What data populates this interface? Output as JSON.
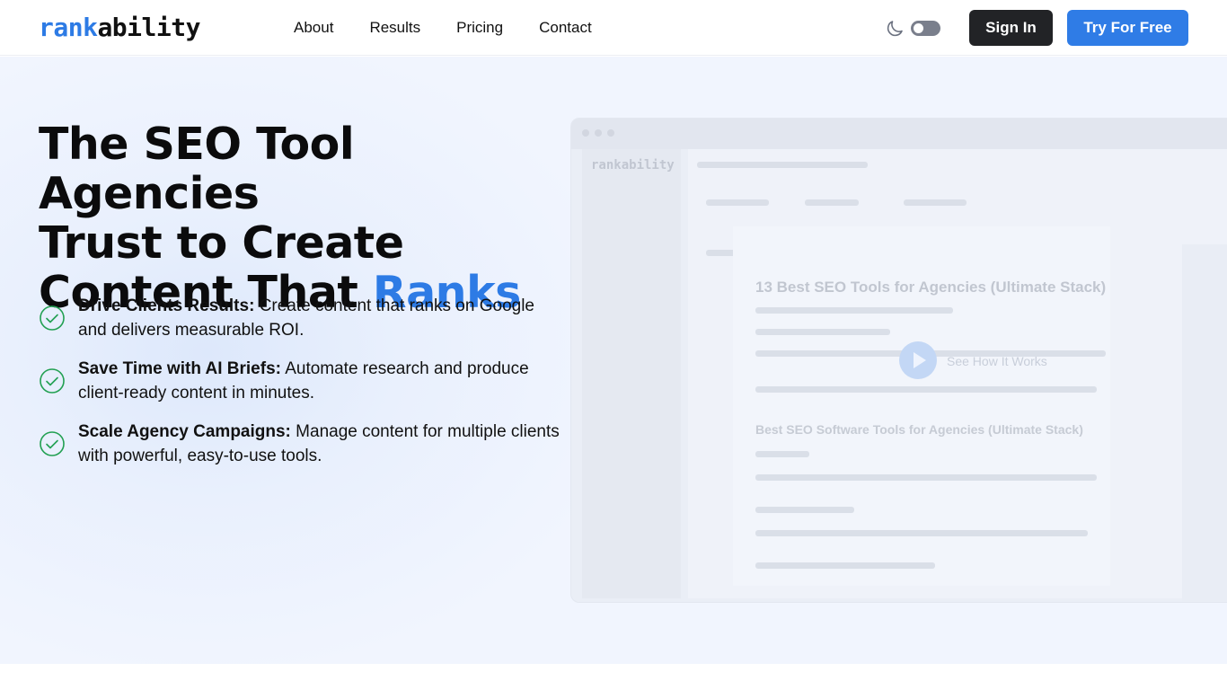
{
  "header": {
    "logo_part1": "rank",
    "logo_part2": "ability",
    "nav": [
      "About",
      "Results",
      "Pricing",
      "Contact"
    ],
    "sign_in_label": "Sign In",
    "try_label": "Try For Free",
    "theme_icon": "moon-icon",
    "theme_toggle_on": false
  },
  "hero": {
    "headline_line1": "The SEO Tool Agencies",
    "headline_line2": "Trust to Create",
    "headline_line3_plain": "Content That ",
    "headline_line3_accent": "Ranks",
    "bullets": [
      {
        "title": "Drive Clients Results:",
        "text": "Create content that ranks on Google and delivers measurable ROI."
      },
      {
        "title": "Save Time with AI Briefs:",
        "text": "Automate research and produce client-ready content in minutes."
      },
      {
        "title": "Scale Agency Campaigns:",
        "text": "Manage content for multiple clients with powerful, easy-to-use tools."
      }
    ]
  },
  "preview": {
    "logo_part1": "rank",
    "logo_part2": "ability",
    "doc_title": "13 Best SEO Tools for Agencies (Ultimate Stack)",
    "section_heading": "Best SEO Software Tools for Agencies (Ultimate Stack)",
    "video_label": "See How It Works"
  },
  "colors": {
    "accent": "#2d7be5",
    "dark_button": "#222326",
    "check": "#22a052"
  }
}
